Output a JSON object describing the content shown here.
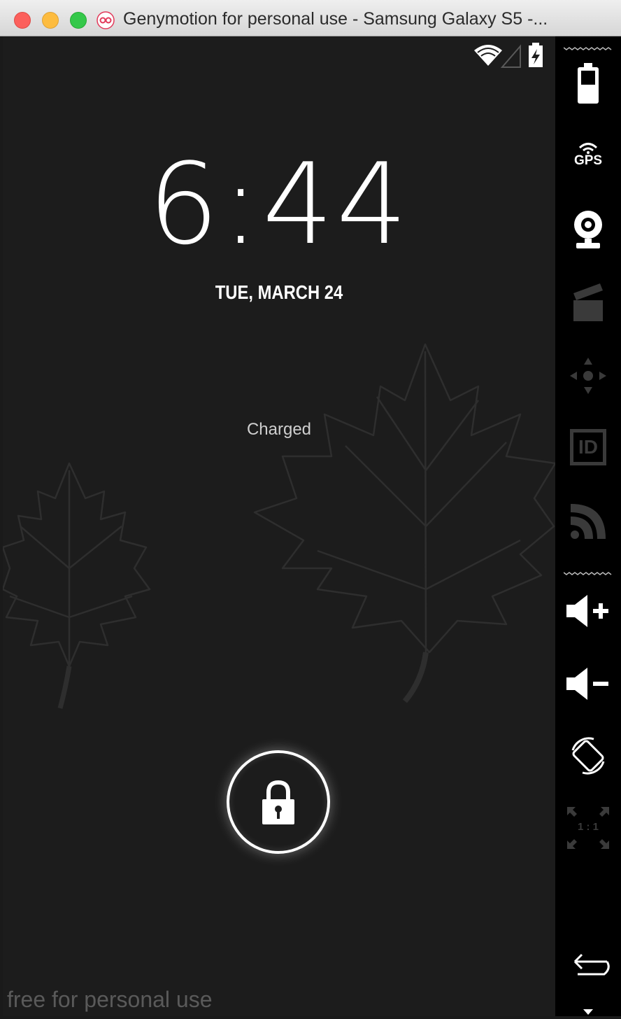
{
  "window": {
    "title": "Genymotion for personal use - Samsung Galaxy S5 -..."
  },
  "lockscreen": {
    "time": "6:44",
    "date": "TUE, MARCH 24",
    "battery_status": "Charged",
    "watermark": "free for personal use"
  },
  "toolbar": {
    "gps_label": "GPS",
    "id_label": "ID",
    "pixel_perfect_label": "1 : 1"
  },
  "colors": {
    "close": "#fc605c",
    "minimize": "#fdbc40",
    "maximize": "#34c84a",
    "logo": "#e23a5b",
    "screen_bg": "#1c1c1c"
  },
  "icons": [
    "wifi-icon",
    "signal-icon",
    "battery-charging-icon",
    "battery-icon",
    "gps-icon",
    "webcam-icon",
    "clapperboard-icon",
    "dpad-icon",
    "id-icon",
    "rss-icon",
    "volume-up-icon",
    "volume-down-icon",
    "rotate-icon",
    "pixel-perfect-icon",
    "back-icon",
    "more-icon",
    "lock-icon"
  ]
}
